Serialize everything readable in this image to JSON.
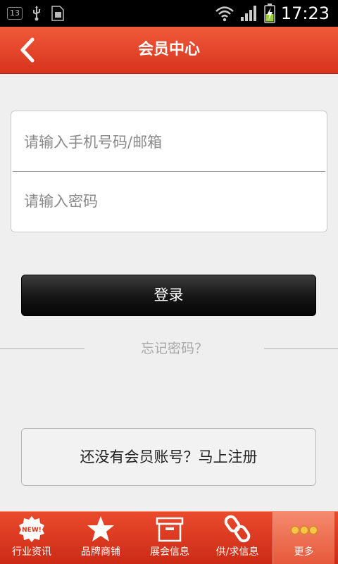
{
  "status_bar": {
    "notification_count": "13",
    "time": "17:23",
    "icons": [
      "usb-icon",
      "sim-icon",
      "wifi-icon",
      "signal-icon",
      "battery-charging-icon"
    ]
  },
  "header": {
    "title": "会员中心",
    "back_icon": "chevron-left-icon"
  },
  "login_form": {
    "username_placeholder": "请输入手机号码/邮箱",
    "password_placeholder": "请输入密码",
    "username_value": "",
    "password_value": "",
    "submit_label": "登录"
  },
  "forgot_password_label": "忘记密码？",
  "register_label": "还没有会员账号？马上注册",
  "bottom_nav": {
    "items": [
      {
        "label": "行业资讯",
        "icon": "new-badge-icon"
      },
      {
        "label": "品牌商铺",
        "icon": "star-icon"
      },
      {
        "label": "展会信息",
        "icon": "box-icon"
      },
      {
        "label": "供/求信息",
        "icon": "chain-link-icon"
      },
      {
        "label": "更多",
        "icon": "more-dots-icon"
      }
    ],
    "active_index": 4
  },
  "colors": {
    "header": "#e0432a",
    "nav": "#d8361e",
    "login_button": "#1a1a1a",
    "page_background": "#efefef",
    "placeholder": "#8a8a8a"
  }
}
